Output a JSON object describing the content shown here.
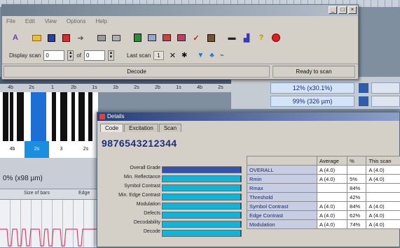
{
  "main_window": {
    "menu": [
      "File",
      "Edit",
      "View",
      "Options",
      "Help"
    ],
    "toolbar_icons": [
      "grade-icon",
      "open-icon",
      "save-icon",
      "copy-icon",
      "arrow-icon",
      "print-icon",
      "printer-icon",
      "green-book-icon",
      "table-icon",
      "bars-icon",
      "chart-icon",
      "check-icon",
      "settings-icon",
      "minus-icon",
      "graph-icon",
      "help-icon",
      "stop-icon"
    ],
    "scan_bar": {
      "display_scan_label": "Display scan",
      "display_scan_value": "0",
      "of_label": "of",
      "of_value": "0",
      "last_scan_label": "Last scan",
      "last_scan_value": "1",
      "scan_icons": [
        "x-icon",
        "gear-icon",
        "filter-icon",
        "network-icon",
        "plug-icon"
      ]
    },
    "status": {
      "mode": "Decode",
      "state": "Ready to scan"
    }
  },
  "ruler": {
    "top_labels": [
      "4b",
      "2s",
      "1",
      "2b",
      "1s",
      "1b",
      "2s",
      "2b",
      "1s",
      "4b",
      "2s"
    ]
  },
  "barcode_labels": [
    "4b",
    "2s",
    "3",
    "2s"
  ],
  "left_panel": {
    "width_text": "0% (x98 µm)",
    "column_headers": [
      "Size of bars",
      "Edge"
    ]
  },
  "right_strip": {
    "value1": "12% (x30.1%)",
    "value2": "99% (326 µm)"
  },
  "details": {
    "title": "Details",
    "tabs": [
      "Code",
      "Excitation",
      "Scan"
    ],
    "barcode_number": "9876543212344",
    "grades": [
      {
        "label": "Overall Grade",
        "level": 1.0
      },
      {
        "label": "Min. Reflectance",
        "level": 1.0
      },
      {
        "label": "Symbol Contrast",
        "level": 1.0
      },
      {
        "label": "Min. Edge Contrast",
        "level": 1.0
      },
      {
        "label": "Modulation",
        "level": 1.0
      },
      {
        "label": "Defects",
        "level": 1.0
      },
      {
        "label": "Decodability",
        "level": 1.0
      },
      {
        "label": "Decode",
        "level": 1.0
      }
    ],
    "table": {
      "headers": [
        "",
        "Average",
        "%",
        "This scan"
      ],
      "rows": [
        {
          "name": "OVERALL",
          "average": "A (4.0)",
          "pct": "",
          "scan": "A (4.0)"
        },
        {
          "name": "Rmin",
          "average": "A (4.0)",
          "pct": "5%",
          "scan": "A (4.0)"
        },
        {
          "name": "Rmax",
          "average": "",
          "pct": "84%",
          "scan": ""
        },
        {
          "name": "Threshold",
          "average": "",
          "pct": "42%",
          "scan": ""
        },
        {
          "name": "Symbol Contrast",
          "average": "A (4.0)",
          "pct": "84%",
          "scan": "A (4.0)"
        },
        {
          "name": "Edge Contrast",
          "average": "A (4.0)",
          "pct": "62%",
          "scan": "A (4.0)"
        },
        {
          "name": "Modulation",
          "average": "A (4.0)",
          "pct": "74%",
          "scan": "A (4.0)"
        }
      ]
    }
  },
  "colors": {
    "grade_bar": "#10b4d8",
    "overall_bar": "#3450b0",
    "barcode_number": "#1a2f86",
    "selected_bar": "#1d6fd6"
  }
}
